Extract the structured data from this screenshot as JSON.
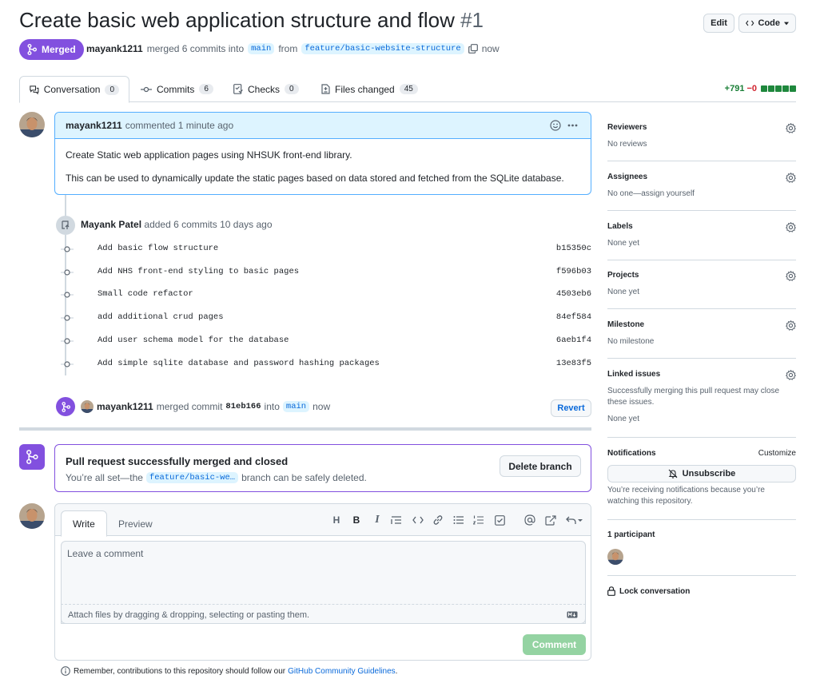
{
  "pr": {
    "title": "Create basic web application structure and flow",
    "number": "#1",
    "state": "Merged",
    "author": "mayank1211",
    "merged_text": "merged 6 commits into",
    "base_branch": "main",
    "from_text": "from",
    "head_branch": "feature/basic-website-structure",
    "when": "now"
  },
  "header_buttons": {
    "edit": "Edit",
    "code": "Code"
  },
  "tabs": [
    {
      "label": "Conversation",
      "count": "0"
    },
    {
      "label": "Commits",
      "count": "6"
    },
    {
      "label": "Checks",
      "count": "0"
    },
    {
      "label": "Files changed",
      "count": "45"
    }
  ],
  "diffstat": {
    "additions": "+791",
    "deletions": "−0"
  },
  "comment": {
    "author": "mayank1211",
    "action": "commented 1 minute ago",
    "body": [
      "Create Static web application pages using NHSUK front-end library.",
      "This can be used to dynamically update the static pages based on data stored and fetched from the SQLite database."
    ]
  },
  "commits_event": {
    "author": "Mayank Patel",
    "text": "added 6 commits 10 days ago"
  },
  "commits": [
    {
      "message": "Add basic flow structure",
      "sha": "b15350c"
    },
    {
      "message": "Add NHS front-end styling to basic pages",
      "sha": "f596b03"
    },
    {
      "message": "Small code refactor",
      "sha": "4503eb6"
    },
    {
      "message": "add additional crud pages",
      "sha": "84ef584"
    },
    {
      "message": "Add user schema model for the database",
      "sha": "6aeb1f4"
    },
    {
      "message": "Add simple sqlite database and password hashing packages",
      "sha": "13e83f5"
    }
  ],
  "merge_event": {
    "author": "mayank1211",
    "text": "merged commit",
    "sha": "81eb166",
    "into": "into",
    "branch": "main",
    "when": "now",
    "revert": "Revert"
  },
  "merge_box": {
    "title": "Pull request successfully merged and closed",
    "text_before": "You’re all set—the",
    "branch": "feature/basic-we…",
    "text_after": "branch can be safely deleted.",
    "delete_button": "Delete branch"
  },
  "editor": {
    "tab_write": "Write",
    "tab_preview": "Preview",
    "placeholder": "Leave a comment",
    "attach": "Attach files by dragging & dropping, selecting or pasting them.",
    "submit": "Comment",
    "footer_text": "Remember, contributions to this repository should follow our",
    "footer_link": "GitHub Community Guidelines",
    "footer_end": "."
  },
  "sidebar": {
    "reviewers": {
      "title": "Reviewers",
      "value": "No reviews"
    },
    "assignees": {
      "title": "Assignees",
      "value": "No one—assign yourself"
    },
    "labels": {
      "title": "Labels",
      "value": "None yet"
    },
    "projects": {
      "title": "Projects",
      "value": "None yet"
    },
    "milestone": {
      "title": "Milestone",
      "value": "No milestone"
    },
    "linked_issues": {
      "title": "Linked issues",
      "description": "Successfully merging this pull request may close these issues.",
      "value": "None yet"
    },
    "notifications": {
      "title": "Notifications",
      "customize": "Customize",
      "button": "Unsubscribe",
      "description": "You’re receiving notifications because you’re watching this repository."
    },
    "participants": {
      "title": "1 participant"
    },
    "lock": "Lock conversation"
  },
  "colors": {
    "merged": "#8250df",
    "link": "#0969da",
    "add": "#1a7f37",
    "del": "#d1242f"
  }
}
